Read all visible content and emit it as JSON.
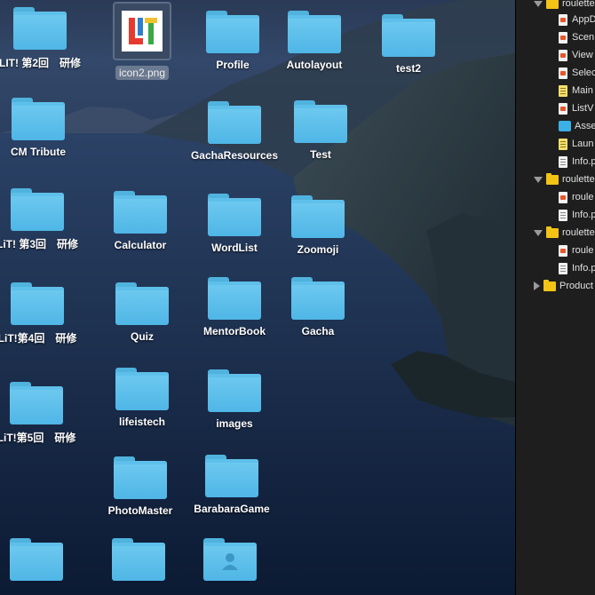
{
  "desktop": {
    "icons": [
      {
        "label": "LIT! 第2回　研修",
        "kind": "folder"
      },
      {
        "label": "icon2.png",
        "kind": "image",
        "selected": true
      },
      {
        "label": "Profile",
        "kind": "folder"
      },
      {
        "label": "Autolayout",
        "kind": "folder"
      },
      {
        "label": "test2",
        "kind": "folder"
      },
      {
        "label": "CM Tribute",
        "kind": "folder"
      },
      {
        "label": "GachaResources",
        "kind": "folder"
      },
      {
        "label": "Test",
        "kind": "folder"
      },
      {
        "label": "LiT! 第3回　研修",
        "kind": "folder"
      },
      {
        "label": "Calculator",
        "kind": "folder"
      },
      {
        "label": "WordList",
        "kind": "folder"
      },
      {
        "label": "Zoomoji",
        "kind": "folder"
      },
      {
        "label": "LiT!第4回　研修",
        "kind": "folder"
      },
      {
        "label": "Quiz",
        "kind": "folder"
      },
      {
        "label": "MentorBook",
        "kind": "folder"
      },
      {
        "label": "Gacha",
        "kind": "folder"
      },
      {
        "label": "LiT!第5回　研修",
        "kind": "folder"
      },
      {
        "label": "lifeistech",
        "kind": "folder"
      },
      {
        "label": "images",
        "kind": "folder"
      },
      {
        "label": "PhotoMaster",
        "kind": "folder"
      },
      {
        "label": "BarabaraGame",
        "kind": "folder"
      },
      {
        "label": "",
        "kind": "folder"
      },
      {
        "label": "",
        "kind": "folder"
      },
      {
        "label": "",
        "kind": "user-folder"
      }
    ],
    "thumbnail_letters": "LiT"
  },
  "navigator": {
    "rows": [
      {
        "label": "roulette",
        "kind": "group",
        "expanded": true
      },
      {
        "label": "AppD",
        "kind": "swift"
      },
      {
        "label": "Scen",
        "kind": "swift"
      },
      {
        "label": "View",
        "kind": "swift"
      },
      {
        "label": "Selec",
        "kind": "swift"
      },
      {
        "label": "Main",
        "kind": "storyboard"
      },
      {
        "label": "ListV",
        "kind": "swift"
      },
      {
        "label": "Asse",
        "kind": "assets"
      },
      {
        "label": "Laun",
        "kind": "storyboard"
      },
      {
        "label": "Info.p",
        "kind": "plist"
      },
      {
        "label": "roulette",
        "kind": "group",
        "expanded": true
      },
      {
        "label": "roule",
        "kind": "swift"
      },
      {
        "label": "Info.p",
        "kind": "plist"
      },
      {
        "label": "roulette",
        "kind": "group",
        "expanded": true
      },
      {
        "label": "roule",
        "kind": "swift"
      },
      {
        "label": "Info.p",
        "kind": "plist"
      },
      {
        "label": "Product",
        "kind": "group",
        "expanded": false
      }
    ]
  },
  "colors": {
    "folder": "#5ec0ea",
    "navigator_bg": "#1e1e1e",
    "group_folder": "#f3c316",
    "swift_icon": "#e8542b"
  }
}
